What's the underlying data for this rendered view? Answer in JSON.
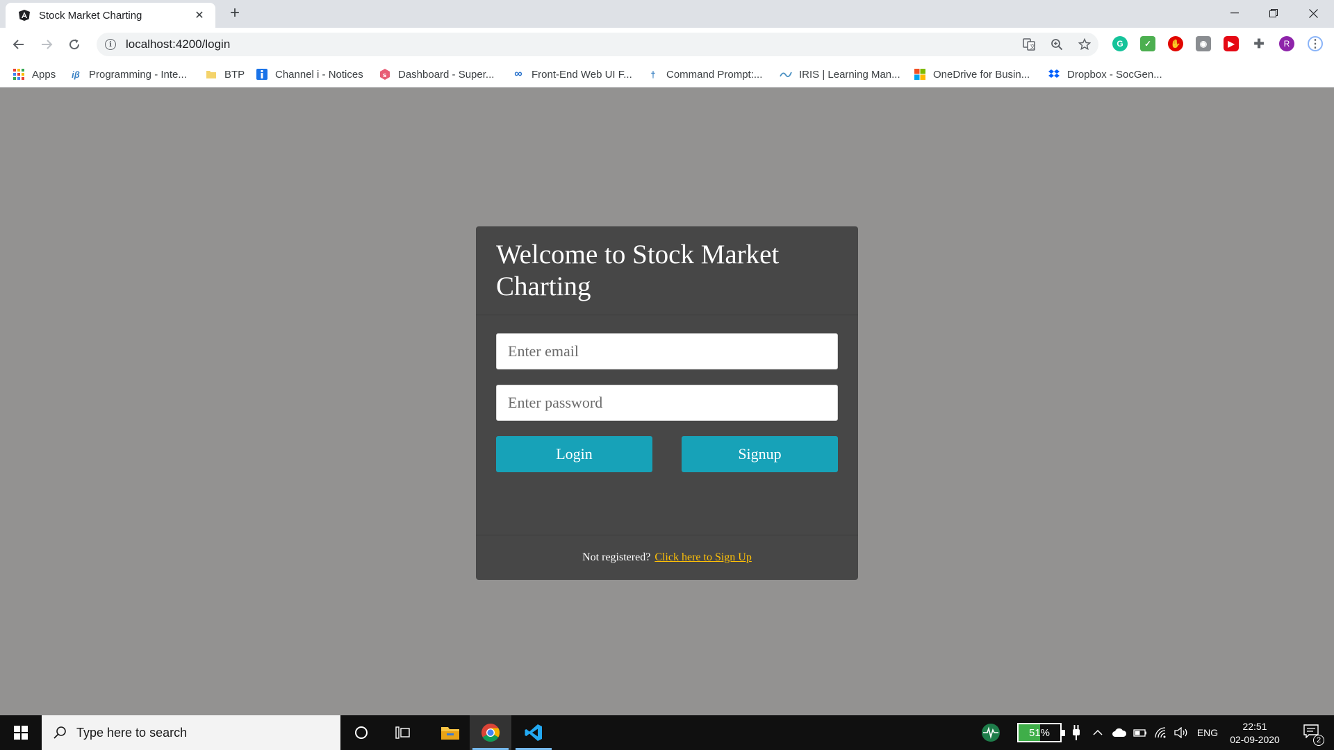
{
  "browser": {
    "tab_title": "Stock Market Charting",
    "url": "localhost:4200/login",
    "profile_initial": "R"
  },
  "bookmarks": [
    {
      "label": "Apps",
      "icon": "apps-grid-icon"
    },
    {
      "label": "Programming - Inte...",
      "icon": "ib-logo-icon"
    },
    {
      "label": "BTP",
      "icon": "folder-icon"
    },
    {
      "label": "Channel i - Notices",
      "icon": "channel-i-icon"
    },
    {
      "label": "Dashboard - Super...",
      "icon": "supermemo-icon"
    },
    {
      "label": "Front-End Web UI F...",
      "icon": "coursera-icon"
    },
    {
      "label": "Command Prompt:...",
      "icon": "pin-icon"
    },
    {
      "label": "IRIS | Learning Man...",
      "icon": "iris-icon"
    },
    {
      "label": "OneDrive for Busin...",
      "icon": "microsoft-icon"
    },
    {
      "label": "Dropbox - SocGen...",
      "icon": "dropbox-icon"
    }
  ],
  "login": {
    "title": "Welcome to Stock Market Charting",
    "email_placeholder": "Enter email",
    "password_placeholder": "Enter password",
    "login_label": "Login",
    "signup_label": "Signup",
    "footer_text": "Not registered?",
    "footer_link": "Click here to Sign Up"
  },
  "taskbar": {
    "search_placeholder": "Type here to search",
    "battery": "51%",
    "language": "ENG",
    "time": "22:51",
    "date": "02-09-2020",
    "notifications": "2"
  },
  "colors": {
    "page_bg": "#939291",
    "card_bg": "#474747",
    "button": "#17a2b8",
    "link": "#ffc107"
  }
}
